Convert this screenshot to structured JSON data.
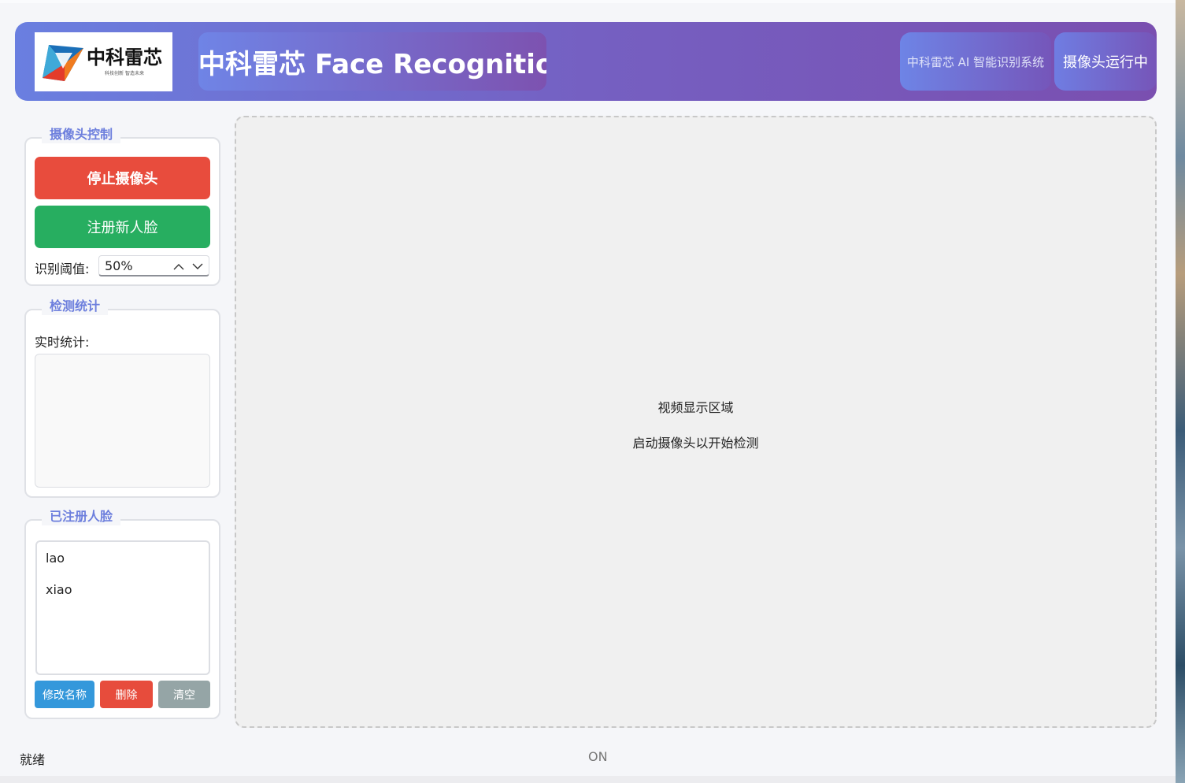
{
  "header": {
    "logo": {
      "title": "中科雷芯",
      "subtitle": "科技创新 智造未来"
    },
    "title": "中科雷芯 Face Recognition",
    "system_name": "中科雷芯 AI 智能识别系统",
    "camera_status": "摄像头运行中"
  },
  "camera_control": {
    "title": "摄像头控制",
    "stop_button": "停止摄像头",
    "register_button": "注册新人脸",
    "threshold_label": "识别阈值:",
    "threshold_value": "50%"
  },
  "stats": {
    "title": "检测统计",
    "label": "实时统计:"
  },
  "registered": {
    "title": "已注册人脸",
    "faces": [
      "lao",
      "xiao"
    ],
    "rename_button": "修改名称",
    "delete_button": "删除",
    "clear_button": "清空"
  },
  "video": {
    "line1": "视频显示区域",
    "line2": "启动摄像头以开始检测"
  },
  "status_bar": {
    "left": "就绪",
    "center": "ON"
  },
  "colors": {
    "header_start": "#6a7fe0",
    "header_end": "#7a4fb0",
    "stop": "#e84c3d",
    "register": "#27ae60",
    "rename": "#3498db",
    "delete": "#e74c3c",
    "clear": "#95a5a6",
    "group_title": "#6d7fdd"
  }
}
